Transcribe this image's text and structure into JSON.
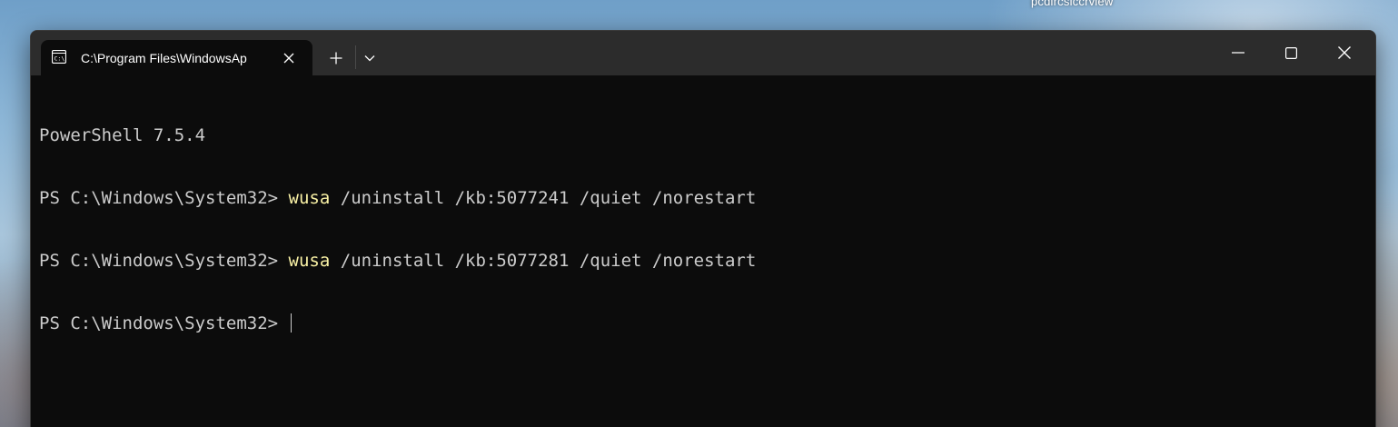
{
  "desktop": {
    "label": "pcdircsiccrview"
  },
  "window": {
    "tab": {
      "title": "C:\\Program Files\\WindowsAp",
      "icon": "cmd-icon"
    },
    "controls": {
      "new_tab_icon": "plus-icon",
      "dropdown_icon": "chevron-down-icon",
      "minimize_icon": "minimize-icon",
      "maximize_icon": "maximize-icon",
      "close_icon": "close-icon"
    }
  },
  "terminal": {
    "banner": "PowerShell 7.5.4",
    "prompt": "PS C:\\Windows\\System32> ",
    "history": [
      {
        "command": "wusa",
        "args": " /uninstall /kb:5077241 /quiet /norestart"
      },
      {
        "command": "wusa",
        "args": " /uninstall /kb:5077281 /quiet /norestart"
      }
    ],
    "colors": {
      "background": "#0c0c0c",
      "foreground": "#cccccc",
      "command": "#f9f1a5"
    }
  }
}
